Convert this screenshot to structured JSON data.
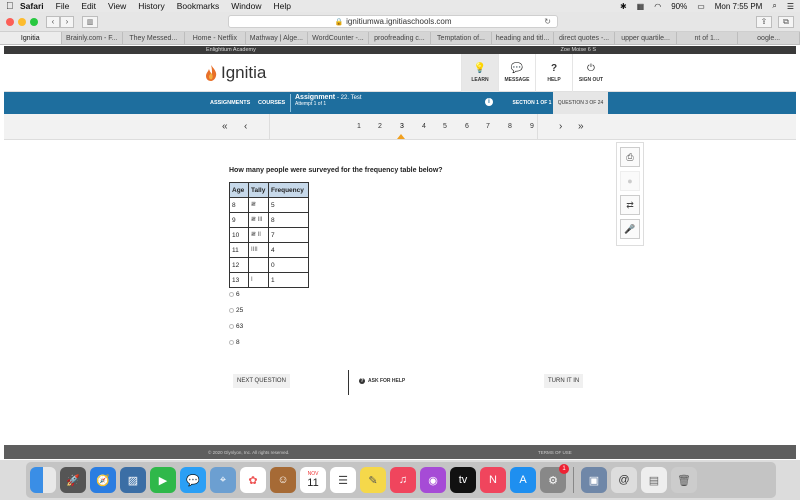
{
  "menubar": {
    "app": "Safari",
    "items": [
      "File",
      "Edit",
      "View",
      "History",
      "Bookmarks",
      "Window",
      "Help"
    ],
    "battery": "90%",
    "time": "Mon 7:55 PM"
  },
  "browser": {
    "url": "ignitiumwa.ignitiaschools.com",
    "tabs": [
      "Ignitia",
      "Brainly.com - F...",
      "They Messed...",
      "Home - Netflix",
      "Mathway | Alge...",
      "WordCounter -...",
      "proofreading c...",
      "Temptation of...",
      "heading and titl...",
      "direct quotes -...",
      "upper quartile...",
      "nt of 1...",
      "oogle..."
    ]
  },
  "page": {
    "school": "Enlightium Academy",
    "user": "Zoe Moise 6 S",
    "logo": "Ignitia",
    "nav": [
      {
        "label": "LEARN",
        "icon": "💡"
      },
      {
        "label": "MESSAGE",
        "icon": "💬"
      },
      {
        "label": "HELP",
        "icon": "?"
      },
      {
        "label": "SIGN OUT",
        "icon": "⏻"
      }
    ],
    "bluebar": {
      "assignments": "ASSIGNMENTS",
      "courses": "COURSES",
      "assignment_label": "Assignment",
      "assignment_name": "- 22. Test",
      "attempt": "Attempt 1 of 1",
      "section": "SECTION 1 OF 1",
      "question": "QUESTION 3 OF 24"
    },
    "pager": {
      "first": "«",
      "prev": "‹",
      "next": "›",
      "last": "»",
      "pages": [
        "1",
        "2",
        "3",
        "4",
        "5",
        "6",
        "7",
        "8",
        "9"
      ],
      "current": "3"
    },
    "question_text": "How many people were surveyed for the frequency table below?",
    "table": {
      "headers": [
        "Age",
        "Tally",
        "Frequency"
      ],
      "rows": [
        [
          "8",
          "𝍸",
          "5"
        ],
        [
          "9",
          "𝍸 III",
          "8"
        ],
        [
          "10",
          "𝍸 II",
          "7"
        ],
        [
          "11",
          "IIII",
          "4"
        ],
        [
          "12",
          "",
          "0"
        ],
        [
          "13",
          "I",
          "1"
        ]
      ]
    },
    "choices": [
      "6",
      "25",
      "63",
      "8"
    ],
    "buttons": {
      "next": "NEXT QUESTION",
      "help": "ASK FOR HELP",
      "turnin": "TURN IT IN"
    },
    "footer": {
      "copyright": "© 2020 Glynlyon, Inc. All rights reserved.",
      "terms": "TERMS OF USE"
    }
  },
  "dock": {
    "calendar_day": "11",
    "calendar_month": "NOV",
    "badge": "1"
  },
  "colors": {
    "bluebar": "#1e6e9e",
    "table_header": "#c7d9ea",
    "accent": "#f0a020"
  }
}
